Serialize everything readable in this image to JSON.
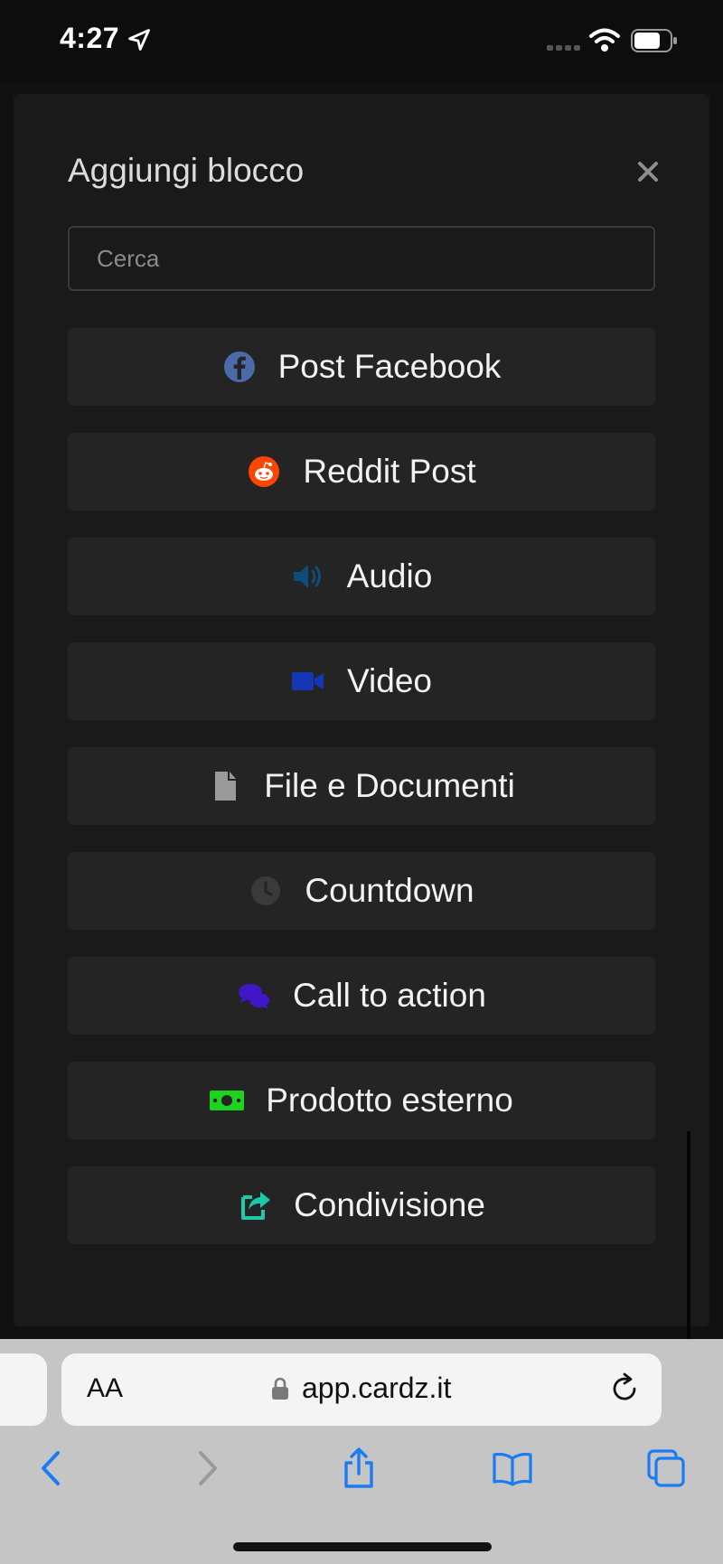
{
  "status_bar": {
    "time": "4:27"
  },
  "modal": {
    "title": "Aggiungi blocco",
    "search_placeholder": "Cerca",
    "items": [
      {
        "label": "Post Facebook",
        "icon": "facebook-icon",
        "color": "#4a6aa8"
      },
      {
        "label": "Reddit Post",
        "icon": "reddit-icon",
        "color": "#ff4500"
      },
      {
        "label": "Audio",
        "icon": "speaker-icon",
        "color": "#0e4d78"
      },
      {
        "label": "Video",
        "icon": "video-camera-icon",
        "color": "#1437b8"
      },
      {
        "label": "File e Documenti",
        "icon": "file-icon",
        "color": "#9a9a9a"
      },
      {
        "label": "Countdown",
        "icon": "clock-icon",
        "color": "#3a3a3a"
      },
      {
        "label": "Call to action",
        "icon": "chat-bubbles-icon",
        "color": "#3f16c8"
      },
      {
        "label": "Prodotto esterno",
        "icon": "money-bill-icon",
        "color": "#1ed31e"
      },
      {
        "label": "Condivisione",
        "icon": "share-icon",
        "color": "#1ec8a8"
      }
    ]
  },
  "browser": {
    "text_size_label": "AA",
    "url": "app.cardz.it",
    "accent": "#1a7cf5"
  }
}
